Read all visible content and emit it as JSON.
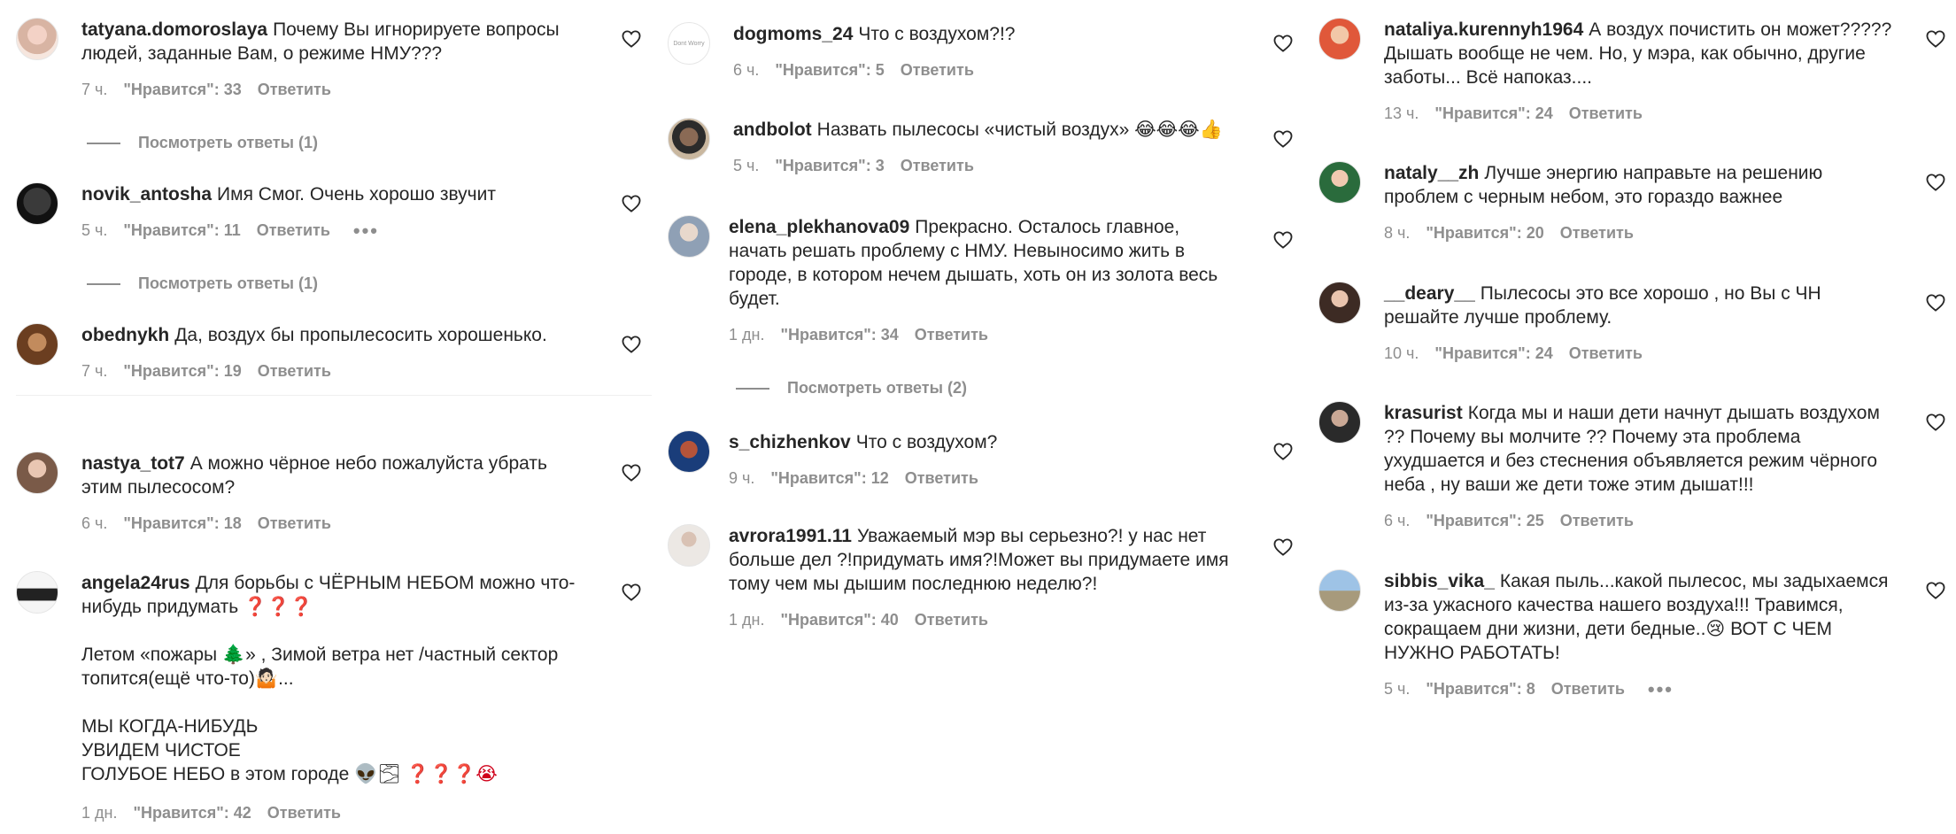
{
  "common": {
    "likes_label": "\"Нравится\"",
    "reply_label": "Ответить",
    "more_label": "•••"
  },
  "col1": [
    {
      "user": "tatyana.domoroslaya",
      "text": "Почему Вы игнорируете вопросы людей, заданные Вам, о режиме НМУ???",
      "time": "7 ч.",
      "likes": "33",
      "view_replies": "Посмотреть ответы (1)"
    },
    {
      "user": "novik_antosha",
      "text": "Имя Смог. Очень хорошо звучит",
      "time": "5 ч.",
      "likes": "11",
      "view_replies": "Посмотреть ответы (1)"
    },
    {
      "user": "obednykh",
      "text": "Да, воздух бы пропылесосить хорошенько.",
      "time": "7 ч.",
      "likes": "19"
    },
    {
      "user": "nastya_tot7",
      "text": "А можно чёрное небо пожалуйста убрать этим пылесосом?",
      "time": "6 ч.",
      "likes": "18"
    },
    {
      "user": "angela24rus",
      "text": "Для борьбы с ЧЁРНЫМ НЕБОМ можно что-нибудь придумать",
      "text_marks": "❓❓❓",
      "line2": "Летом «пожары 🌲» , Зимой ветра нет /частный сектор топится(ещё что-то)🤷🏻...",
      "line3": "МЫ КОГДА-НИБУДЬ",
      "line4": "УВИДЕМ ЧИСТОЕ",
      "line5": "ГОЛУБОЕ НЕБО в этом городе 👽🌫",
      "line5_marks": "❓❓❓😭",
      "time": "1 дн.",
      "likes": "42"
    }
  ],
  "col2": [
    {
      "user": "dogmoms_24",
      "text": "Что с воздухом?!?",
      "time": "6 ч.",
      "likes": "5",
      "avatar_text": "Dont Worry"
    },
    {
      "user": "andbolot",
      "text": "Назвать пылесосы «чистый воздух» 😂😂😂👍",
      "time": "5 ч.",
      "likes": "3"
    },
    {
      "user": "elena_plekhanova09",
      "text": "Прекрасно. Осталось главное, начать решать проблему с НМУ. Невыносимо жить в городе, в котором нечем дышать, хоть он из золота весь будет.",
      "time": "1 дн.",
      "likes": "34",
      "view_replies": "Посмотреть ответы (2)"
    },
    {
      "user": "s_chizhenkov",
      "text": "Что с воздухом?",
      "time": "9 ч.",
      "likes": "12"
    },
    {
      "user": "avrora1991.11",
      "text": "Уважаемый мэр вы серьезно?! у нас нет больше дел ?!придумать имя?!Может вы придумаете имя тому чем мы дышим последнюю неделю?!",
      "time": "1 дн.",
      "likes": "40"
    }
  ],
  "col3": [
    {
      "user": "nataliya.kurennyh1964",
      "text": "А воздух почистить он может????? Дышать вообще не чем. Но, у мэра, как обычно, другие заботы... Всё напоказ....",
      "time": "13 ч.",
      "likes": "24"
    },
    {
      "user": "nataly__zh",
      "text": "Лучше энергию направьте на решению проблем с черным небом, это гораздо важнее",
      "time": "8 ч.",
      "likes": "20"
    },
    {
      "user": "__deary__",
      "text": "Пылесосы это все хорошо , но Вы с ЧН решайте лучше проблему.",
      "time": "10 ч.",
      "likes": "24"
    },
    {
      "user": "krasurist",
      "text": "Когда мы и наши дети начнут дышать воздухом ?? Почему вы молчите ?? Почему эта проблема ухудшается и без стеснения объявляется режим чёрного неба , ну ваши же дети тоже этим дышат!!!",
      "time": "6 ч.",
      "likes": "25"
    },
    {
      "user": "sibbis_vika_",
      "text": "Какая пыль...какой пылесос, мы задыхаемся из-за ужасного качества нашего воздуха!!! Травимся, сокращаем дни жизни, дети бедные..😢 ВОТ С ЧЕМ НУЖНО РАБОТАТЬ!",
      "time": "5 ч.",
      "likes": "8"
    }
  ],
  "colors": {
    "text": "#262626",
    "secondary": "#8e8e8e",
    "question_mark": "#d0021b"
  }
}
